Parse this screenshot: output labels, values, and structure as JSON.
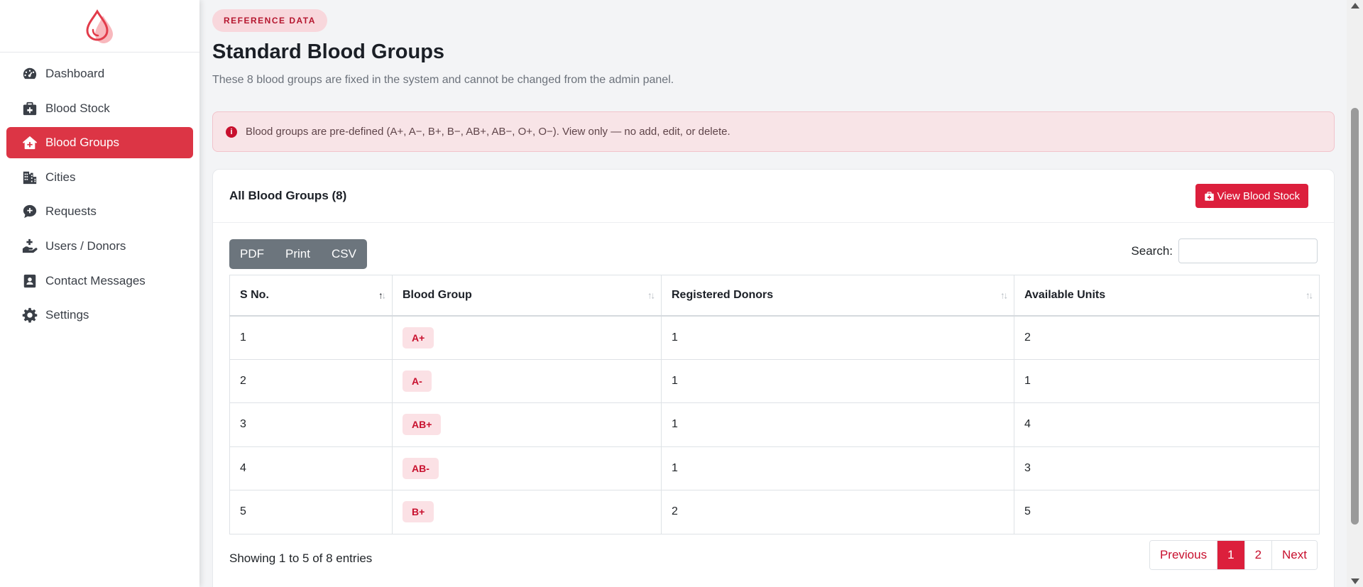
{
  "colors": {
    "accent": "#dc3545",
    "brand": "#c8102e",
    "badge_bg": "#f8d7dc"
  },
  "sidebar": {
    "logo_icon": "blood-drop-icon",
    "items": [
      {
        "label": "Dashboard",
        "icon": "gauge-icon"
      },
      {
        "label": "Blood Stock",
        "icon": "medkit-icon"
      },
      {
        "label": "Blood Groups",
        "icon": "house-medical-icon",
        "active": true
      },
      {
        "label": "Cities",
        "icon": "city-icon"
      },
      {
        "label": "Requests",
        "icon": "comment-medical-icon"
      },
      {
        "label": "Users / Donors",
        "icon": "hand-holding-medical-icon"
      },
      {
        "label": "Contact Messages",
        "icon": "address-card-icon"
      },
      {
        "label": "Settings",
        "icon": "gear-icon"
      }
    ]
  },
  "header": {
    "badge": "REFERENCE DATA",
    "title": "Standard Blood Groups",
    "subtitle": "These 8 blood groups are fixed in the system and cannot be changed from the admin panel."
  },
  "alert": {
    "icon": "info-circle-icon",
    "text": "Blood groups are pre-defined (A+, A−, B+, B−, AB+, AB−, O+, O−). View only — no add, edit, or delete."
  },
  "card": {
    "title": "All Blood Groups (8)",
    "view_stock_label": "View Blood Stock",
    "export_buttons": [
      "PDF",
      "Print",
      "CSV"
    ],
    "search_label": "Search:",
    "search_value": "",
    "columns": [
      "S No.",
      "Blood Group",
      "Registered Donors",
      "Available Units"
    ],
    "rows": [
      {
        "sno": "1",
        "group": "A+",
        "donors": "1",
        "units": "2"
      },
      {
        "sno": "2",
        "group": "A-",
        "donors": "1",
        "units": "1"
      },
      {
        "sno": "3",
        "group": "AB+",
        "donors": "1",
        "units": "4"
      },
      {
        "sno": "4",
        "group": "AB-",
        "donors": "1",
        "units": "3"
      },
      {
        "sno": "5",
        "group": "B+",
        "donors": "2",
        "units": "5"
      }
    ],
    "showing": "Showing 1 to 5 of 8 entries",
    "pagination": {
      "previous": "Previous",
      "pages": [
        "1",
        "2"
      ],
      "current": "1",
      "next": "Next"
    }
  }
}
